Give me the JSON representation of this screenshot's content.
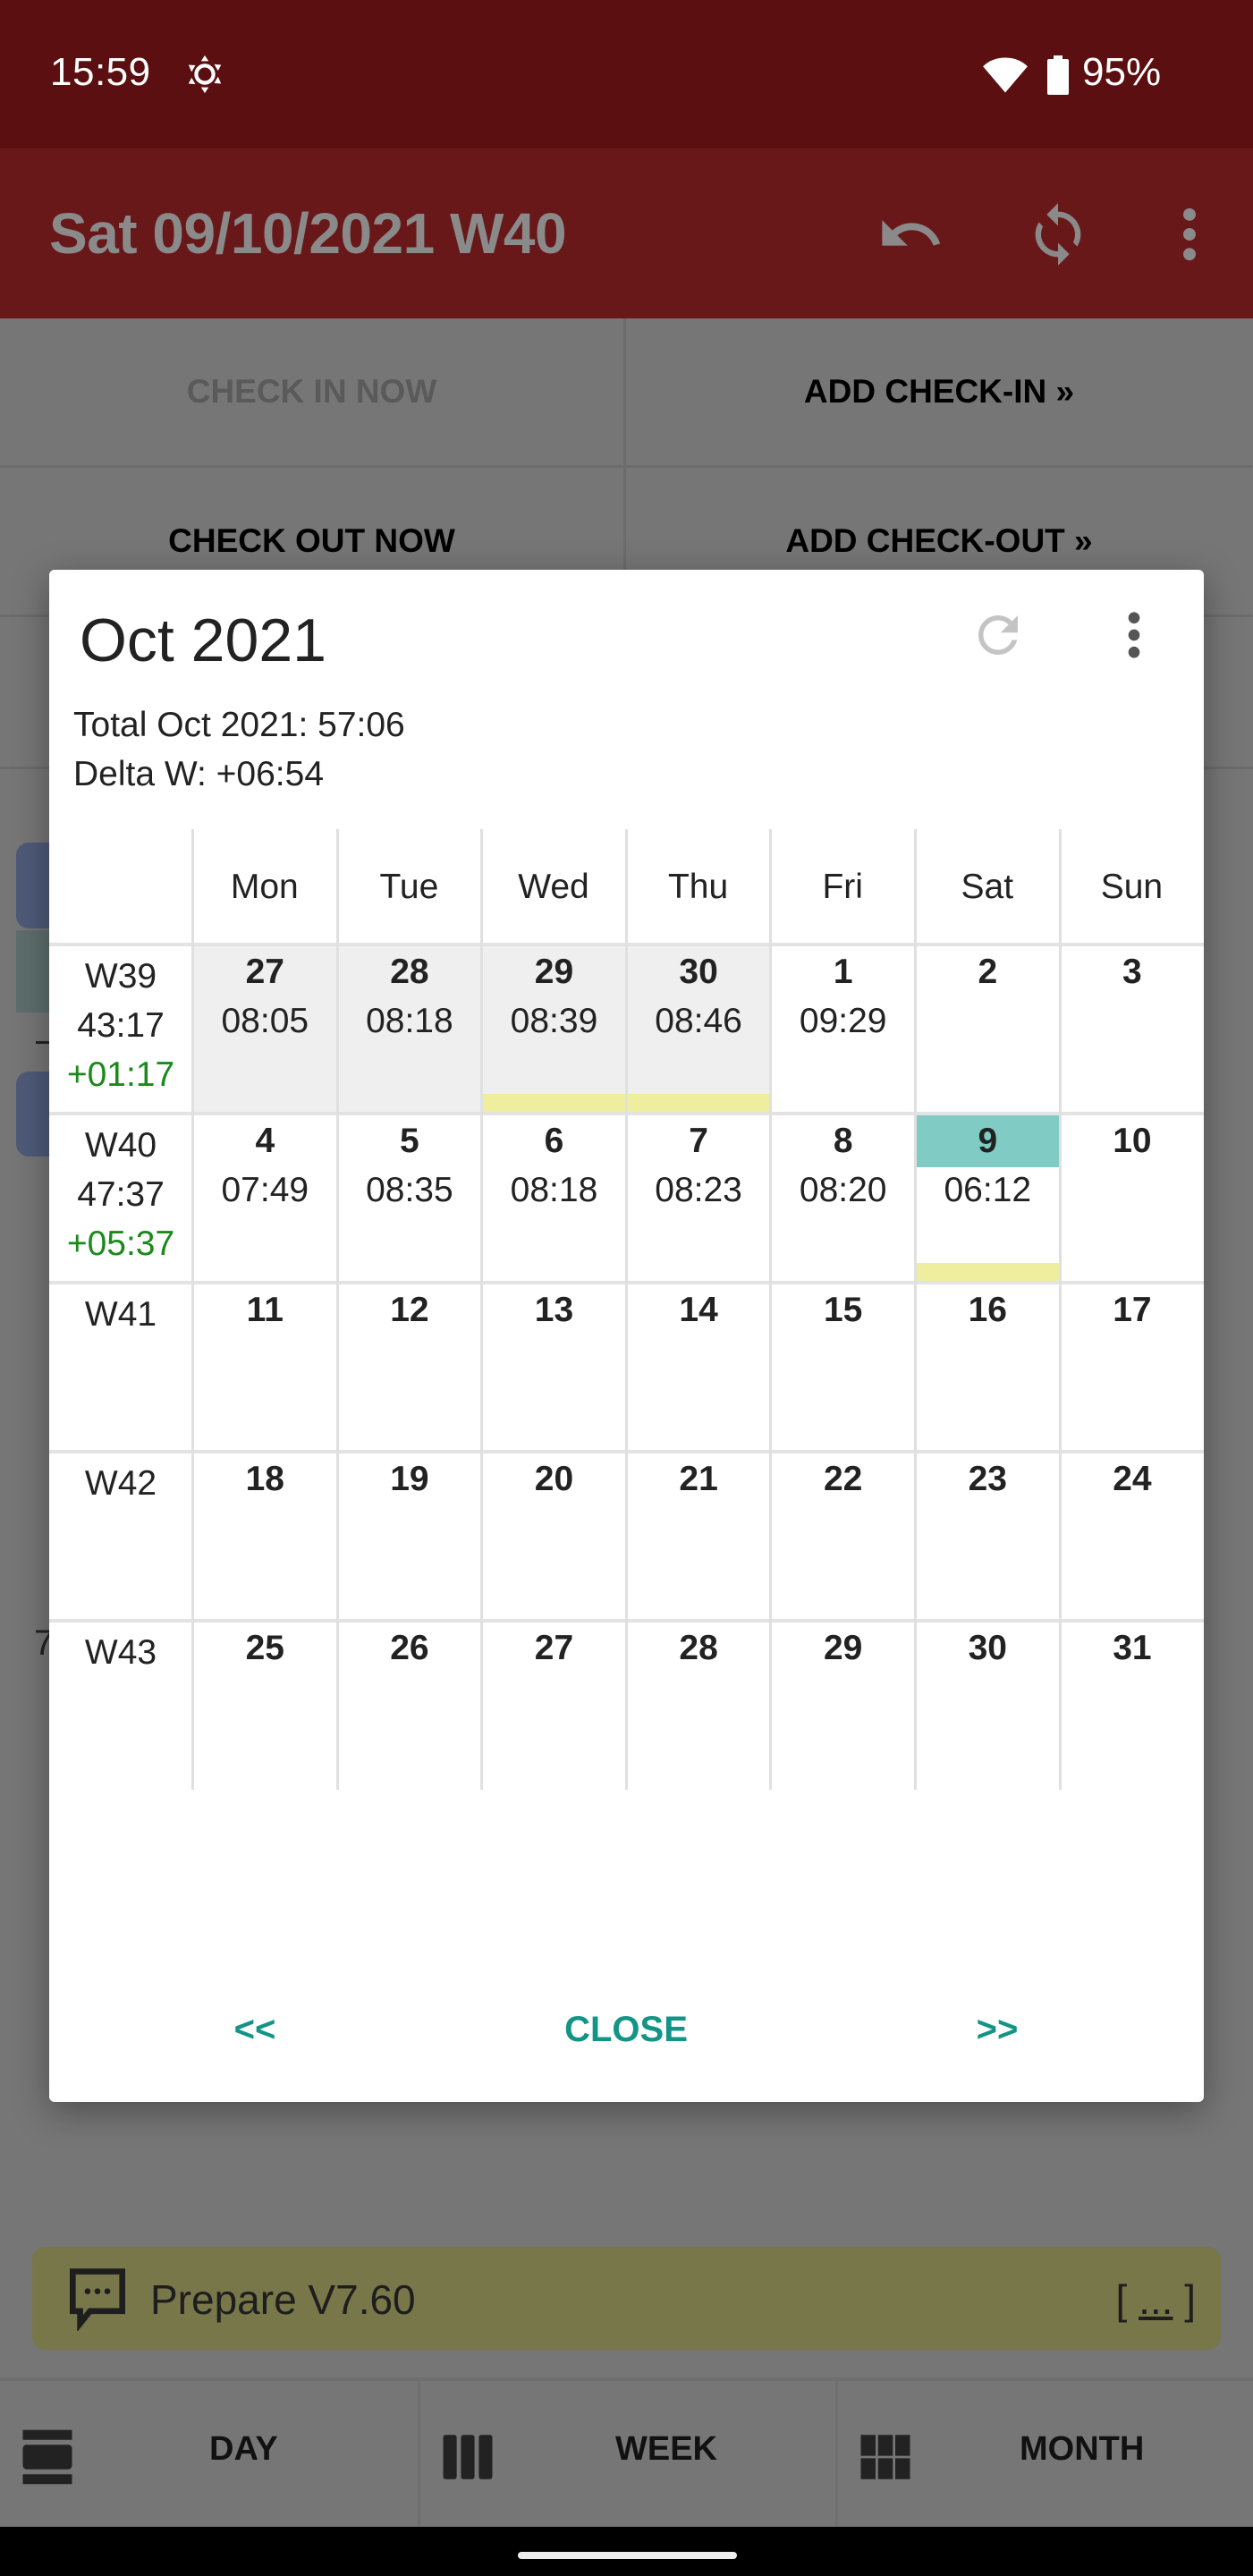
{
  "status_bar": {
    "time": "15:59",
    "icons": [
      "brightness-auto-icon",
      "wifi-icon",
      "battery-icon"
    ],
    "battery_percent": "95%"
  },
  "toolbar": {
    "title": "Sat 09/10/2021 W40",
    "actions": [
      "undo-icon",
      "sync-icon",
      "more-vert-icon"
    ]
  },
  "actions": {
    "check_in_now": "CHECK IN NOW",
    "add_check_in": "ADD CHECK-IN »",
    "check_out_now": "CHECK OUT NOW",
    "add_check_out": "ADD CHECK-OUT »"
  },
  "background_fragment": "7",
  "dialog": {
    "title": "Oct 2021",
    "total": "Total Oct 2021: 57:06",
    "delta": "Delta W: +06:54",
    "weekdays": [
      "Mon",
      "Tue",
      "Wed",
      "Thu",
      "Fri",
      "Sat",
      "Sun"
    ],
    "weeks": [
      {
        "label": "W39",
        "total": "43:17",
        "delta": "+01:17",
        "days": [
          {
            "day": "27",
            "time": "08:05",
            "outside_month": true,
            "bar": false
          },
          {
            "day": "28",
            "time": "08:18",
            "outside_month": true,
            "bar": false
          },
          {
            "day": "29",
            "time": "08:39",
            "outside_month": true,
            "bar": true
          },
          {
            "day": "30",
            "time": "08:46",
            "outside_month": true,
            "bar": true
          },
          {
            "day": "1",
            "time": "09:29",
            "bar": false
          },
          {
            "day": "2",
            "time": "",
            "bar": false
          },
          {
            "day": "3",
            "time": "",
            "bar": false
          }
        ]
      },
      {
        "label": "W40",
        "total": "47:37",
        "delta": "+05:37",
        "days": [
          {
            "day": "4",
            "time": "07:49"
          },
          {
            "day": "5",
            "time": "08:35"
          },
          {
            "day": "6",
            "time": "08:18"
          },
          {
            "day": "7",
            "time": "08:23"
          },
          {
            "day": "8",
            "time": "08:20"
          },
          {
            "day": "9",
            "time": "06:12",
            "today": true,
            "bar": true
          },
          {
            "day": "10",
            "time": ""
          }
        ]
      },
      {
        "label": "W41",
        "total": "",
        "delta": "",
        "days": [
          {
            "day": "11"
          },
          {
            "day": "12"
          },
          {
            "day": "13"
          },
          {
            "day": "14"
          },
          {
            "day": "15"
          },
          {
            "day": "16"
          },
          {
            "day": "17"
          }
        ]
      },
      {
        "label": "W42",
        "total": "",
        "delta": "",
        "days": [
          {
            "day": "18"
          },
          {
            "day": "19"
          },
          {
            "day": "20"
          },
          {
            "day": "21"
          },
          {
            "day": "22"
          },
          {
            "day": "23"
          },
          {
            "day": "24"
          }
        ]
      },
      {
        "label": "W43",
        "total": "",
        "delta": "",
        "days": [
          {
            "day": "25"
          },
          {
            "day": "26"
          },
          {
            "day": "27"
          },
          {
            "day": "28"
          },
          {
            "day": "29"
          },
          {
            "day": "30"
          },
          {
            "day": "31"
          }
        ]
      }
    ],
    "prev_label": "<<",
    "close_label": "CLOSE",
    "next_label": ">>",
    "colors": {
      "accent": "#139487",
      "today": "#80cbc4",
      "bar": "#eeee9e",
      "delta_positive": "#1b8a1b"
    }
  },
  "note": {
    "text": "Prepare V7.60",
    "more_open": "[ ",
    "more_link": "...",
    "more_close": " ]"
  },
  "nav": {
    "day": "DAY",
    "week": "WEEK",
    "month": "MONTH"
  }
}
